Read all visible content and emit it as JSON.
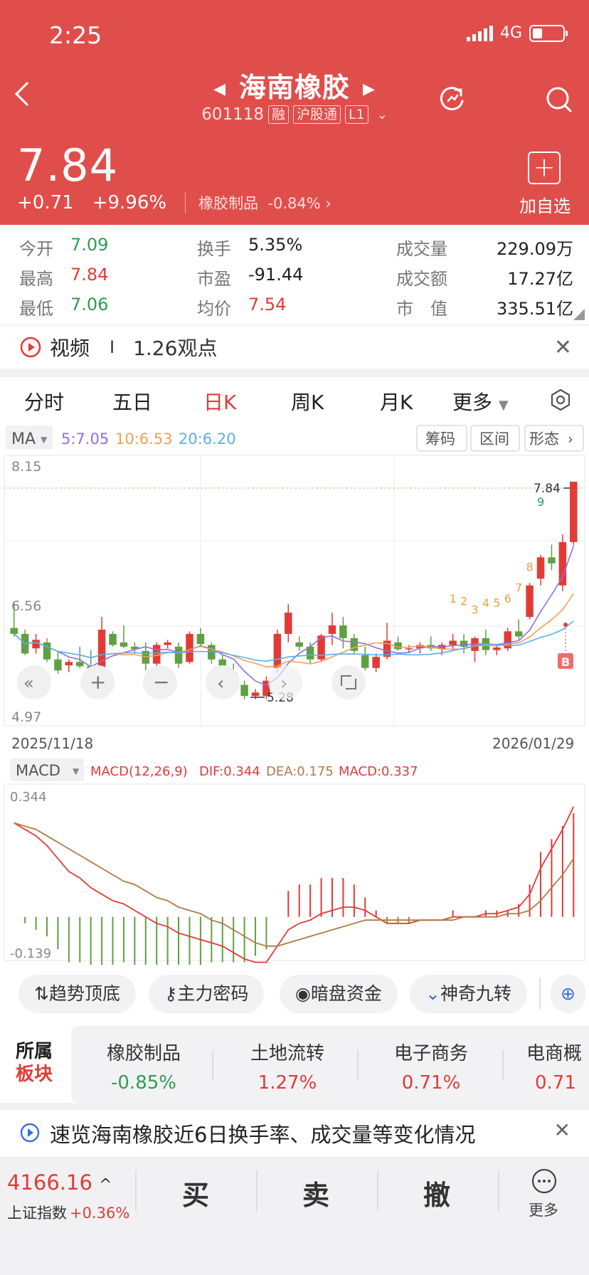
{
  "status": {
    "time": "2:25",
    "network": "4G"
  },
  "stock": {
    "name": "海南橡胶",
    "code": "601118",
    "tag_rong": "融",
    "tag_hgt": "沪股通",
    "tag_level": "L1",
    "price": "7.84",
    "change": "+0.71",
    "change_pct": "+9.96%",
    "sector": "橡胶制品",
    "sector_pct": "-0.84%",
    "add_label": "加自选"
  },
  "stats": {
    "open_label": "今开",
    "open": "7.09",
    "high_label": "最高",
    "high": "7.84",
    "low_label": "最低",
    "low": "7.06",
    "turnover_label": "换手",
    "turnover": "5.35%",
    "pe_label": "市盈",
    "pe": "-91.44",
    "avg_label": "均价",
    "avg": "7.54",
    "volume_label": "成交量",
    "volume": "229.09万",
    "amount_label": "成交额",
    "amount": "17.27亿",
    "mcap_label": "市　值",
    "mcap": "335.51亿"
  },
  "video_row": {
    "label": "视频",
    "sep": "I",
    "views": "1.26观点"
  },
  "tabs": [
    {
      "label": "分时"
    },
    {
      "label": "五日"
    },
    {
      "label": "日K"
    },
    {
      "label": "周K"
    },
    {
      "label": "月K"
    },
    {
      "label": "更多"
    }
  ],
  "ma": {
    "select": "MA",
    "ma5": "5:7.05",
    "ma10": "10:6.53",
    "ma20": "20:6.20"
  },
  "chart_buttons": [
    "筹码",
    "区间",
    "形态"
  ],
  "kline_labels": {
    "top": "8.15",
    "mid": "6.56",
    "bottom": "4.97",
    "last_price": "7.84",
    "low_price": "5.28",
    "date_start": "2025/11/18",
    "date_end": "2026/01/29",
    "b_marker": "B",
    "nine_marks": [
      "1",
      "2",
      "3",
      "4",
      "5",
      "6",
      "7",
      "8",
      "9"
    ]
  },
  "macd": {
    "select": "MACD",
    "params": "MACD(12,26,9)",
    "dif": "DIF:0.344",
    "dea": "DEA:0.175",
    "macd": "MACD:0.337",
    "top": "0.344",
    "bottom": "-0.139"
  },
  "colors": {
    "up": "#e23b36",
    "down": "#5fa043",
    "ma5": "#8f6fe0",
    "ma10": "#f0a057",
    "ma20": "#5aaef0",
    "header": "#e04e4b"
  },
  "chart_data": {
    "type": "candlestick",
    "ylim": [
      4.97,
      8.15
    ],
    "start_date": "2025/11/18",
    "end_date": "2026/01/29",
    "ohlc": [
      [
        6.12,
        6.42,
        6.02,
        6.05
      ],
      [
        6.05,
        6.1,
        5.8,
        5.82
      ],
      [
        5.88,
        6.05,
        5.82,
        5.98
      ],
      [
        5.95,
        6.0,
        5.72,
        5.75
      ],
      [
        5.75,
        5.85,
        5.58,
        5.62
      ],
      [
        5.68,
        5.75,
        5.6,
        5.72
      ],
      [
        5.72,
        5.9,
        5.65,
        5.67
      ],
      [
        5.67,
        5.86,
        5.52,
        5.55
      ],
      [
        5.55,
        6.25,
        5.55,
        6.1
      ],
      [
        6.05,
        6.08,
        5.9,
        5.92
      ],
      [
        5.95,
        6.15,
        5.88,
        5.9
      ],
      [
        5.9,
        5.95,
        5.82,
        5.87
      ],
      [
        5.85,
        5.95,
        5.62,
        5.7
      ],
      [
        5.7,
        5.95,
        5.65,
        5.92
      ],
      [
        5.92,
        5.98,
        5.88,
        5.95
      ],
      [
        5.9,
        5.95,
        5.65,
        5.7
      ],
      [
        5.72,
        6.08,
        5.7,
        6.05
      ],
      [
        6.05,
        6.12,
        5.9,
        5.93
      ],
      [
        5.92,
        5.95,
        5.7,
        5.75
      ],
      [
        5.75,
        5.8,
        5.5,
        5.6
      ],
      [
        5.6,
        5.7,
        5.38,
        5.45
      ],
      [
        5.45,
        5.5,
        5.28,
        5.32
      ],
      [
        5.32,
        5.4,
        5.28,
        5.36
      ],
      [
        5.32,
        5.55,
        5.28,
        5.5
      ],
      [
        5.65,
        6.1,
        5.6,
        6.05
      ],
      [
        6.05,
        6.4,
        5.95,
        6.3
      ],
      [
        5.95,
        6.02,
        5.85,
        5.9
      ],
      [
        5.9,
        5.95,
        5.7,
        5.75
      ],
      [
        5.75,
        6.05,
        5.72,
        6.03
      ],
      [
        6.05,
        6.3,
        5.92,
        6.15
      ],
      [
        6.15,
        6.25,
        5.88,
        6.0
      ],
      [
        6.0,
        6.05,
        5.82,
        5.85
      ],
      [
        5.8,
        5.9,
        5.62,
        5.65
      ],
      [
        5.65,
        5.82,
        5.6,
        5.78
      ],
      [
        5.78,
        6.18,
        5.75,
        5.97
      ],
      [
        5.95,
        6.02,
        5.85,
        5.87
      ],
      [
        5.87,
        5.92,
        5.83,
        5.88
      ],
      [
        5.88,
        5.95,
        5.82,
        5.92
      ],
      [
        5.92,
        6.02,
        5.85,
        5.88
      ],
      [
        5.87,
        5.95,
        5.8,
        5.92
      ],
      [
        5.92,
        6.05,
        5.85,
        5.97
      ],
      [
        5.97,
        6.05,
        5.82,
        5.9
      ],
      [
        5.85,
        6.02,
        5.72,
        6.0
      ],
      [
        6.0,
        6.1,
        5.8,
        5.86
      ],
      [
        5.86,
        5.92,
        5.8,
        5.89
      ],
      [
        5.88,
        6.12,
        5.85,
        6.08
      ],
      [
        6.08,
        6.22,
        5.98,
        6.02
      ],
      [
        6.25,
        6.65,
        6.22,
        6.62
      ],
      [
        6.7,
        6.98,
        6.62,
        6.95
      ],
      [
        6.95,
        7.1,
        6.8,
        6.88
      ],
      [
        6.62,
        7.22,
        6.55,
        7.13
      ],
      [
        7.13,
        7.84,
        7.09,
        7.84
      ]
    ],
    "macd_dif": [
      0.29,
      0.27,
      0.25,
      0.22,
      0.18,
      0.14,
      0.12,
      0.09,
      0.07,
      0.05,
      0.04,
      0.02,
      0.0,
      -0.02,
      -0.03,
      -0.05,
      -0.06,
      -0.07,
      -0.08,
      -0.09,
      -0.11,
      -0.13,
      -0.14,
      -0.14,
      -0.09,
      -0.04,
      -0.02,
      -0.01,
      0.01,
      0.02,
      0.03,
      0.03,
      0.02,
      0.0,
      -0.02,
      -0.02,
      -0.02,
      -0.01,
      -0.01,
      -0.01,
      0.0,
      0.0,
      0.0,
      0.01,
      0.01,
      0.02,
      0.03,
      0.07,
      0.15,
      0.21,
      0.27,
      0.34
    ],
    "macd_dea": [
      0.29,
      0.28,
      0.27,
      0.25,
      0.23,
      0.21,
      0.19,
      0.17,
      0.15,
      0.13,
      0.11,
      0.1,
      0.08,
      0.06,
      0.05,
      0.03,
      0.02,
      0.01,
      -0.01,
      -0.02,
      -0.04,
      -0.06,
      -0.08,
      -0.09,
      -0.09,
      -0.08,
      -0.07,
      -0.06,
      -0.05,
      -0.04,
      -0.03,
      -0.02,
      -0.01,
      -0.01,
      -0.01,
      -0.01,
      -0.01,
      -0.01,
      -0.01,
      -0.01,
      -0.01,
      0.0,
      0.0,
      0.0,
      0.0,
      0.01,
      0.01,
      0.02,
      0.05,
      0.09,
      0.13,
      0.18
    ]
  },
  "tools": [
    "趋势顶底",
    "主力密码",
    "暗盘资金",
    "神奇九转"
  ],
  "sectors": {
    "title1": "所属",
    "title2": "板块",
    "items": [
      {
        "name": "橡胶制品",
        "pct": "-0.85%"
      },
      {
        "name": "土地流转",
        "pct": "1.27%"
      },
      {
        "name": "电子商务",
        "pct": "0.71%"
      },
      {
        "name": "电商概",
        "pct": "0.71"
      }
    ]
  },
  "news": {
    "text": "速览海南橡胶近6日换手率、成交量等变化情况"
  },
  "bottom": {
    "index_value": "4166.16",
    "index_name": "上证指数",
    "index_pct": "+0.36%",
    "buy": "买",
    "sell": "卖",
    "cancel": "撤",
    "more": "更多"
  }
}
